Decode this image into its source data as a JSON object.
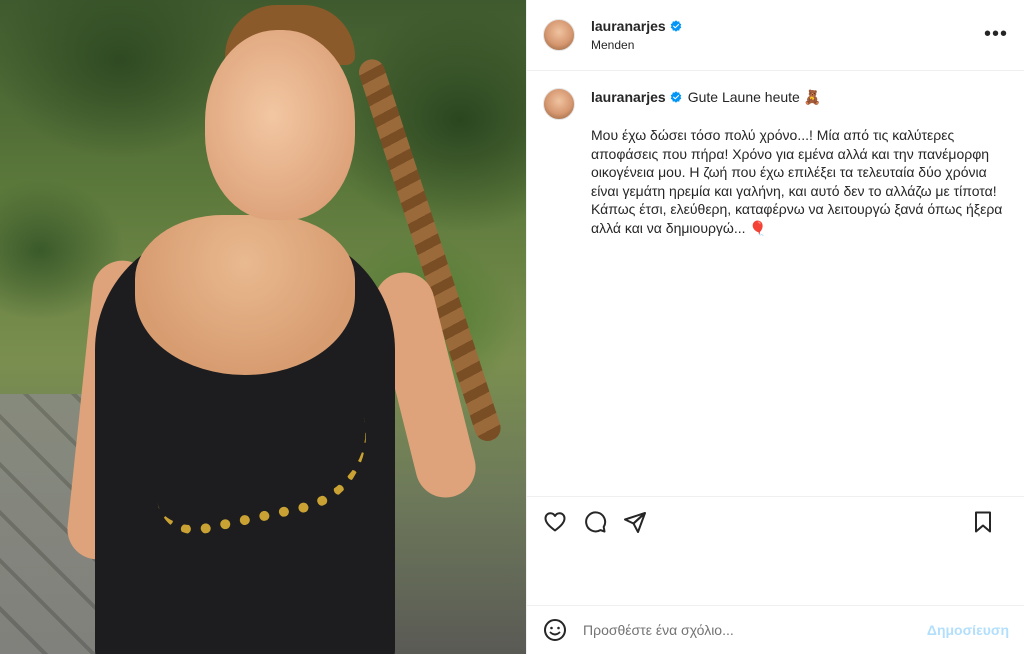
{
  "post": {
    "username": "lauranarjes",
    "location": "Menden",
    "verified": true
  },
  "caption": {
    "username": "lauranarjes",
    "title": "Gute Laune heute",
    "title_emoji": "🧸",
    "body": "Μου έχω δώσει τόσο πολύ χρόνο...! Μία από τις καλύτερες αποφάσεις που πήρα! Χρόνο για εμένα αλλά και την πανέμορφη οικογένεια μου. Η ζωή που έχω επιλέξει τα τελευταία δύο χρόνια είναι γεμάτη ηρεμία και γαλήνη, και αυτό δεν το αλλάζω με τίποτα! Κάπως έτσι, ελεύθερη, καταφέρνω να λειτουργώ ξανά όπως ήξερα αλλά και να δημιουργώ... 🎈"
  },
  "comment": {
    "placeholder": "Προσθέστε ένα σχόλιο...",
    "post_label": "Δημοσίευση"
  },
  "colors": {
    "verified_blue": "#0095f6",
    "text": "#262626",
    "post_disabled": "#b2dffc"
  },
  "icons": [
    "verified-badge-icon",
    "more-options-icon",
    "heart-icon",
    "comment-icon",
    "share-icon",
    "bookmark-icon",
    "emoji-icon"
  ]
}
